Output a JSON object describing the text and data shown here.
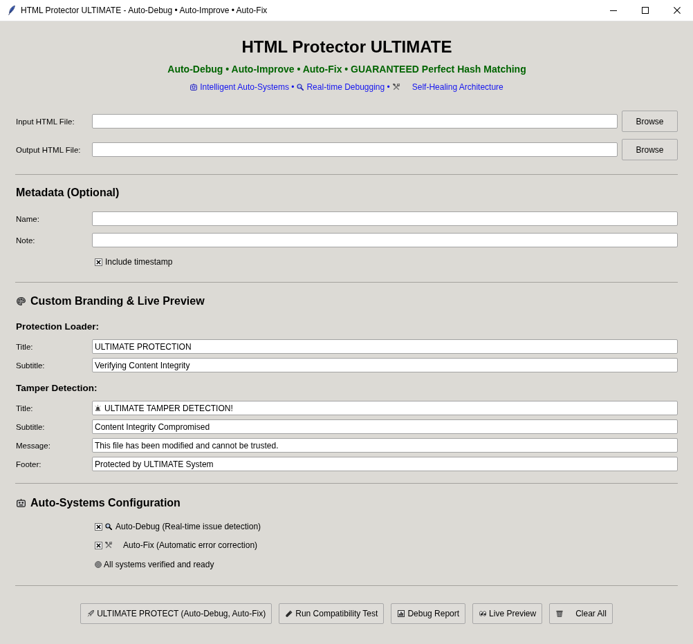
{
  "window": {
    "title": "HTML Protector ULTIMATE - Auto-Debug • Auto-Improve • Auto-Fix"
  },
  "header": {
    "title": "HTML Protector ULTIMATE",
    "tagline": "Auto-Debug • Auto-Improve • Auto-Fix • GUARANTEED Perfect Hash Matching",
    "features": [
      {
        "label": "Intelligent Auto-Systems •"
      },
      {
        "label": "Real-time Debugging •"
      },
      {
        "label": "Self-Healing Architecture"
      }
    ]
  },
  "files": [
    {
      "label": "Input HTML File:",
      "button": "Browse"
    },
    {
      "label": "Output HTML File:",
      "button": "Browse"
    }
  ],
  "metadata": {
    "heading": "Metadata (Optional)",
    "fields": [
      {
        "label": "Name:"
      },
      {
        "label": "Note:"
      }
    ],
    "include_timestamp": {
      "label": "Include timestamp",
      "checked": true
    }
  },
  "branding": {
    "heading": "Custom Branding & Live Preview",
    "groups": [
      {
        "heading": "Protection Loader:",
        "fields": [
          {
            "label": "Title:",
            "value": "ULTIMATE PROTECTION",
            "kind": "plain"
          },
          {
            "label": "Subtitle:",
            "value": "Verifying Content Integrity",
            "kind": "plain"
          }
        ]
      },
      {
        "heading": "Tamper Detection:",
        "fields": [
          {
            "label": "Title:",
            "value": "ULTIMATE TAMPER DETECTION!",
            "kind": "alert"
          },
          {
            "label": "Subtitle:",
            "value": "Content Integrity Compromised",
            "kind": "plain"
          },
          {
            "label": "Message:",
            "value": "This file has been modified and cannot be trusted.",
            "kind": "plain"
          },
          {
            "label": "Footer:",
            "value": "Protected by ULTIMATE System",
            "kind": "plain"
          }
        ]
      }
    ]
  },
  "auto_systems": {
    "heading": "Auto-Systems Configuration",
    "options": [
      {
        "label": "Auto-Debug (Real-time issue detection)",
        "checked": true
      },
      {
        "label": "Auto-Fix (Automatic error correction)",
        "checked": true
      }
    ],
    "status": "All systems verified and ready"
  },
  "actions": [
    {
      "label": "ULTIMATE PROTECT (Auto-Debug, Auto-Fix)"
    },
    {
      "label": "Run Compatibility Test"
    },
    {
      "label": "Debug Report"
    },
    {
      "label": "Live Preview"
    },
    {
      "label": "Clear All"
    }
  ]
}
